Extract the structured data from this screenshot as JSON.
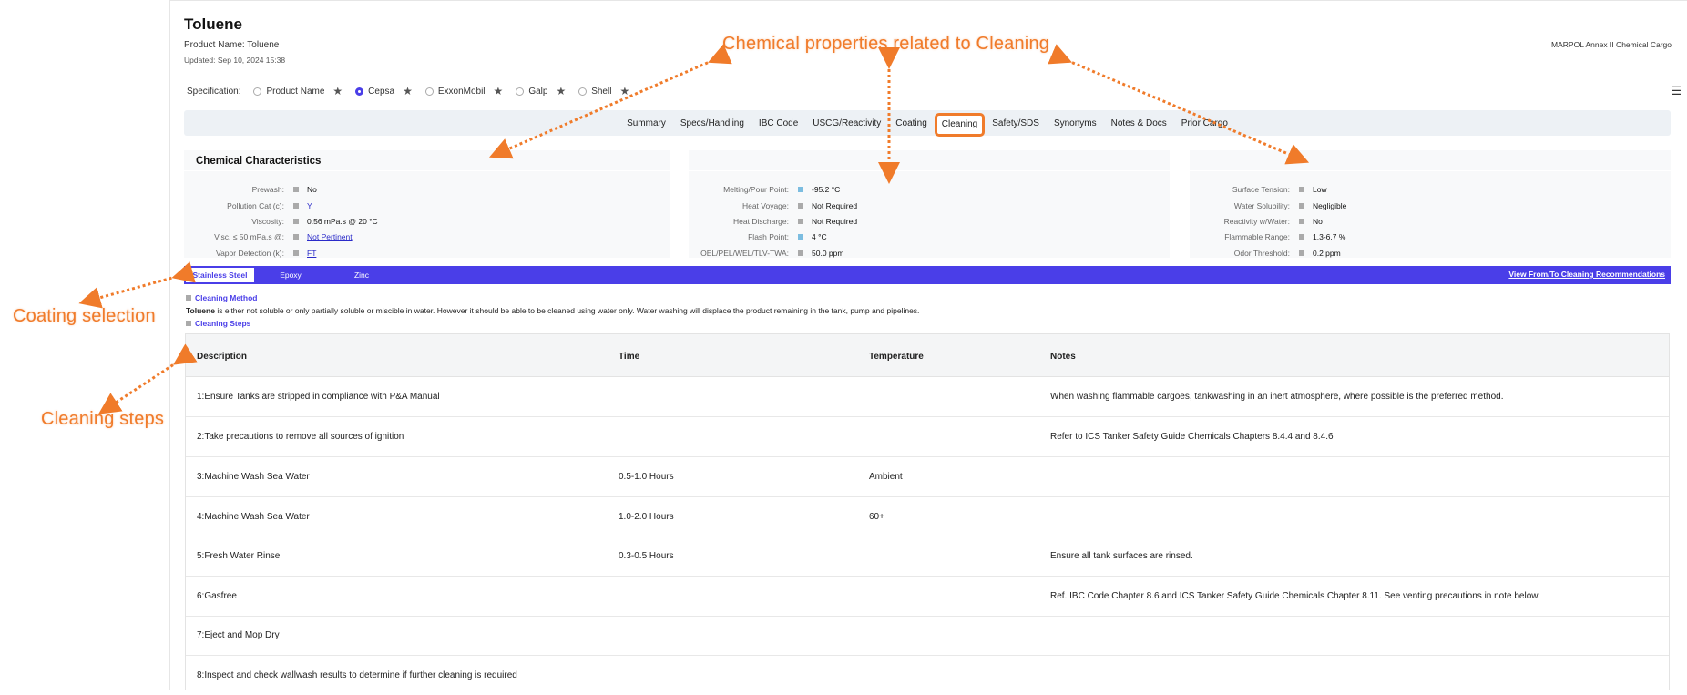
{
  "product": {
    "title": "Toluene",
    "product_name_line": "Product Name: Toluene",
    "updated_line": "Updated: Sep 10, 2024 15:38",
    "category": "MARPOL Annex II Chemical Cargo"
  },
  "specification": {
    "label": "Specification:",
    "options": [
      {
        "label": "Product Name",
        "selected": false
      },
      {
        "label": "Cepsa",
        "selected": true
      },
      {
        "label": "ExxonMobil",
        "selected": false
      },
      {
        "label": "Galp",
        "selected": false
      },
      {
        "label": "Shell",
        "selected": false
      }
    ]
  },
  "tabs": [
    "Summary",
    "Specs/Handling",
    "IBC Code",
    "USCG/Reactivity",
    "Coating",
    "Cleaning",
    "Safety/SDS",
    "Synonyms",
    "Notes & Docs",
    "Prior Cargo"
  ],
  "active_tab": "Cleaning",
  "characteristics": {
    "heading": "Chemical Characteristics",
    "col1": [
      {
        "label": "Prewash:",
        "value": "No"
      },
      {
        "label": "Pollution Cat (c):",
        "value": "Y"
      },
      {
        "label": "Viscosity:",
        "value": "0.56 mPa.s @ 20 °C"
      },
      {
        "label": "Visc. ≤ 50 mPa.s @:",
        "value": "Not Pertinent"
      },
      {
        "label": "Vapor Detection (k):",
        "value": "FT"
      }
    ],
    "col2": [
      {
        "label": "Melting/Pour Point:",
        "value": "-95.2 °C"
      },
      {
        "label": "Heat Voyage:",
        "value": "Not Required"
      },
      {
        "label": "Heat Discharge:",
        "value": "Not Required"
      },
      {
        "label": "Flash Point:",
        "value": "4 °C"
      },
      {
        "label": "OEL/PEL/WEL/TLV-TWA:",
        "value": "50.0 ppm"
      }
    ],
    "col3": [
      {
        "label": "Surface Tension:",
        "value": "Low"
      },
      {
        "label": "Water Solubility:",
        "value": "Negligible"
      },
      {
        "label": "Reactivity w/Water:",
        "value": "No"
      },
      {
        "label": "Flammable Range:",
        "value": "1.3-6.7 %"
      },
      {
        "label": "Odor Threshold:",
        "value": "0.2 ppm"
      }
    ]
  },
  "coatings": {
    "tabs": [
      "Stainless Steel",
      "Epoxy",
      "Zinc"
    ],
    "selected": "Stainless Steel",
    "view_link": "View From/To Cleaning Recommendations"
  },
  "cleaning_method": {
    "heading": "Cleaning Method",
    "product": "Toluene",
    "text": " is either not soluble or only partially soluble or miscible in water. However it should be able to be cleaned using water only. Water washing will displace the product remaining in the tank, pump and pipelines."
  },
  "cleaning_steps": {
    "heading": "Cleaning Steps",
    "columns": [
      "Description",
      "Time",
      "Temperature",
      "Notes"
    ],
    "rows": [
      [
        "1:Ensure Tanks are stripped in compliance with P&A Manual",
        "",
        "",
        "When washing flammable cargoes, tankwashing in an inert atmosphere, where possible is the preferred method."
      ],
      [
        "2:Take precautions to remove all sources of ignition",
        "",
        "",
        "Refer to ICS Tanker Safety Guide Chemicals Chapters 8.4.4 and 8.4.6"
      ],
      [
        "3:Machine Wash Sea Water",
        "0.5-1.0 Hours",
        "Ambient",
        ""
      ],
      [
        "4:Machine Wash Sea Water",
        "1.0-2.0 Hours",
        "60+",
        ""
      ],
      [
        "5:Fresh Water Rinse",
        "0.3-0.5 Hours",
        "",
        "Ensure all tank surfaces are rinsed."
      ],
      [
        "6:Gasfree",
        "",
        "",
        "Ref. IBC Code Chapter 8.6 and ICS Tanker Safety Guide Chemicals Chapter 8.11. See venting precautions in note below."
      ],
      [
        "7:Eject and Mop Dry",
        "",
        "",
        ""
      ],
      [
        "8:Inspect and check wallwash results to determine if further cleaning is required",
        "",
        "",
        ""
      ]
    ]
  },
  "annotations": {
    "chemical": "Chemical properties related to Cleaning",
    "coating": "Coating selection",
    "steps": "Cleaning steps"
  },
  "colors": {
    "accent": "#4a3ee8",
    "annotation": "#f07b2a"
  }
}
